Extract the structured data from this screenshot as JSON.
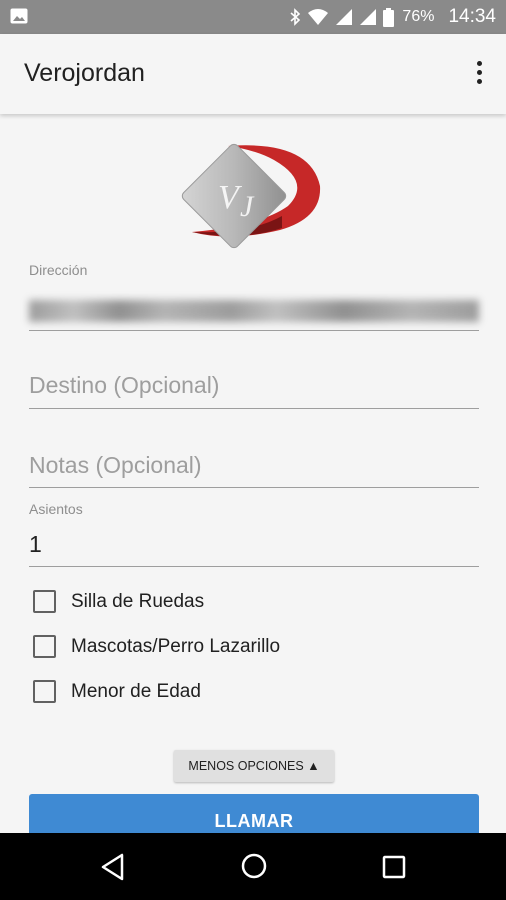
{
  "status_bar": {
    "battery_percent": "76%",
    "time": "14:34",
    "icons": [
      "image-icon",
      "bluetooth-icon",
      "wifi-icon",
      "signal-icon",
      "signal-icon-2",
      "battery-icon"
    ]
  },
  "app_bar": {
    "title": "Verojordan",
    "menu_icon": "more-vert-icon"
  },
  "logo": {
    "text": "VJ",
    "brand_color": "#c62828"
  },
  "form": {
    "direccion": {
      "label": "Dirección",
      "value_obscured": true
    },
    "destino": {
      "placeholder": "Destino (Opcional)"
    },
    "notas": {
      "placeholder": "Notas (Opcional)"
    },
    "asientos": {
      "label": "Asientos",
      "value": "1"
    },
    "options": [
      {
        "label": "Silla de Ruedas",
        "checked": false
      },
      {
        "label": "Mascotas/Perro Lazarillo",
        "checked": false
      },
      {
        "label": "Menor de Edad",
        "checked": false
      }
    ],
    "less_options_label": "MENOS OPCIONES ▲",
    "call_label": "LLAMAR"
  },
  "nav_bar": {
    "icons": [
      "back-icon",
      "home-icon",
      "recents-icon"
    ]
  },
  "colors": {
    "accent": "#3f8ad3",
    "status_bar": "#8a8a8a",
    "background": "#f5f5f5"
  }
}
